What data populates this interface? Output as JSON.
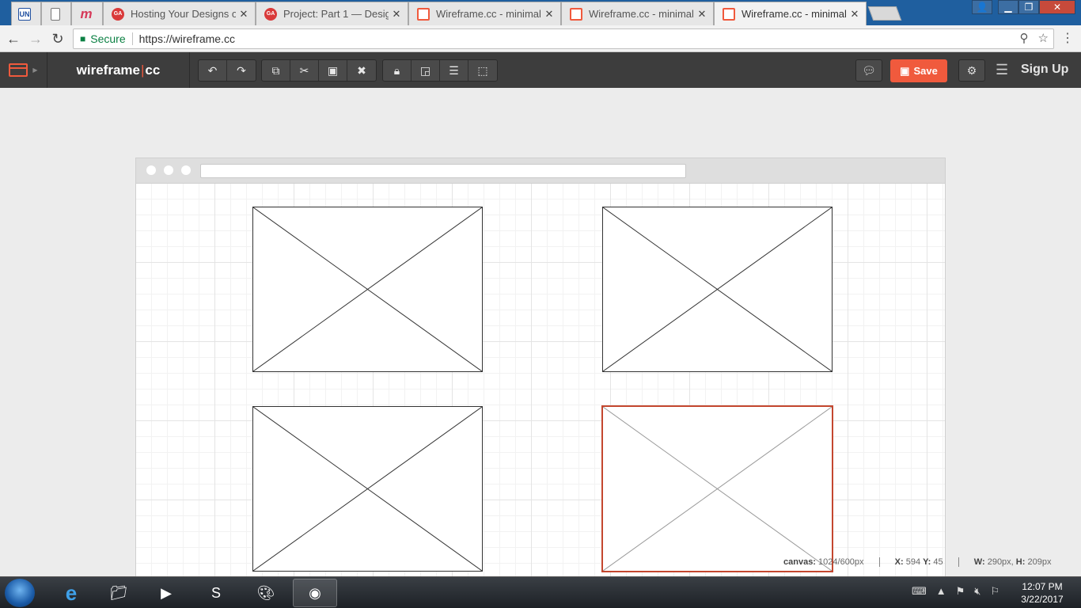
{
  "browser": {
    "tabs": [
      {
        "label": "",
        "icon": "un-icon"
      },
      {
        "label": "",
        "icon": "blank-page-icon"
      },
      {
        "label": "",
        "icon": "m-icon"
      },
      {
        "label": "Hosting Your Designs on",
        "icon": "ga-icon"
      },
      {
        "label": "Project: Part 1 — Design",
        "icon": "ga-icon"
      },
      {
        "label": "Wireframe.cc - minimal w",
        "icon": "wireframe-icon"
      },
      {
        "label": "Wireframe.cc - minimal w",
        "icon": "wireframe-icon"
      },
      {
        "label": "Wireframe.cc - minimal w",
        "icon": "wireframe-icon"
      }
    ],
    "secure_label": "Secure",
    "url": "https://wireframe.cc",
    "un_text": "UN",
    "m_text": "m",
    "ga_text": "GA"
  },
  "app": {
    "brand_left": "wireframe",
    "brand_right": "cc",
    "save_label": "Save",
    "signup_label": "Sign Up"
  },
  "canvas_status": {
    "canvas_label": "canvas:",
    "canvas_size": "1024/600px",
    "x_label": "X:",
    "x_value": "594",
    "y_label": "Y:",
    "y_value": "45",
    "w_label": "W:",
    "w_value": "290px,",
    "h_label": "H:",
    "h_value": "209px"
  },
  "taskbar": {
    "time": "12:07 PM",
    "date": "3/22/2017"
  },
  "colors": {
    "accent": "#f05a3d",
    "toolbar": "#3d3d3d",
    "selection": "#c4472f"
  }
}
